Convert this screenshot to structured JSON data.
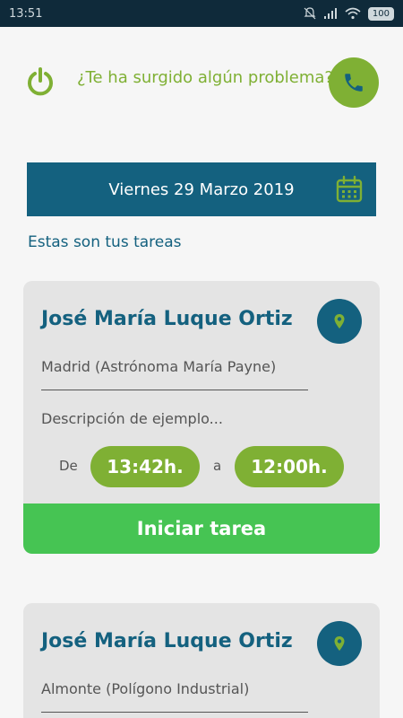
{
  "status_bar": {
    "time": "13:51",
    "battery": "100"
  },
  "header": {
    "problem_text": "¿Te ha surgido algún problema?"
  },
  "date_bar": {
    "date": "Viernes 29 Marzo 2019"
  },
  "tasks_title": "Estas son tus tareas",
  "tasks": [
    {
      "client": "José María Luque Ortiz",
      "address": "Madrid (Astrónoma María Payne)",
      "description": "Descripción de ejemplo...",
      "from_label": "De",
      "start_time": "13:42h.",
      "to_label": "a",
      "end_time": "12:00h.",
      "start_button": "Iniciar tarea"
    },
    {
      "client": "José María Luque Ortiz",
      "address": "Almonte (Polígono Industrial)"
    }
  ],
  "colors": {
    "primary": "#14617f",
    "accent_green": "#7fb034",
    "button_green": "#46c453",
    "card_bg": "#e4e4e4"
  }
}
